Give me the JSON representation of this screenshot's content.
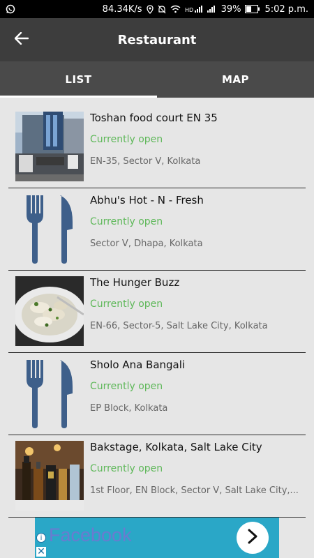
{
  "status_bar": {
    "network_speed": "84.34K/s",
    "battery": "39%",
    "time": "5:02 p.m."
  },
  "app_bar": {
    "title": "Restaurant"
  },
  "tabs": [
    {
      "label": "LIST",
      "active": true
    },
    {
      "label": "MAP",
      "active": false
    }
  ],
  "restaurants": [
    {
      "name": "Toshan food court EN 35",
      "status": "Currently open",
      "address": "EN-35, Sector V, Kolkata",
      "image": "building-photo"
    },
    {
      "name": "Abhu's Hot - N - Fresh",
      "status": "Currently open",
      "address": "Sector V, Dhapa, Kolkata",
      "image": "fork-knife-icon"
    },
    {
      "name": "The Hunger Buzz",
      "status": "Currently open",
      "address": "EN-66, Sector-5, Salt Lake City, Kolkata",
      "image": "food-photo"
    },
    {
      "name": "Sholo Ana Bangali",
      "status": "Currently open",
      "address": "EP Block, Kolkata",
      "image": "fork-knife-icon"
    },
    {
      "name": "Bakstage, Kolkata, Salt Lake City",
      "status": "Currently open",
      "address": "1st Floor, EN Block, Sector V, Salt Lake City,...",
      "image": "bar-photo"
    }
  ],
  "ad": {
    "text": "Facebook"
  },
  "colors": {
    "status_open": "#5fb85a",
    "app_bar": "#3d3d3d",
    "tab_bar": "#4a4a4a",
    "fork_knife": "#3e5f8a"
  }
}
